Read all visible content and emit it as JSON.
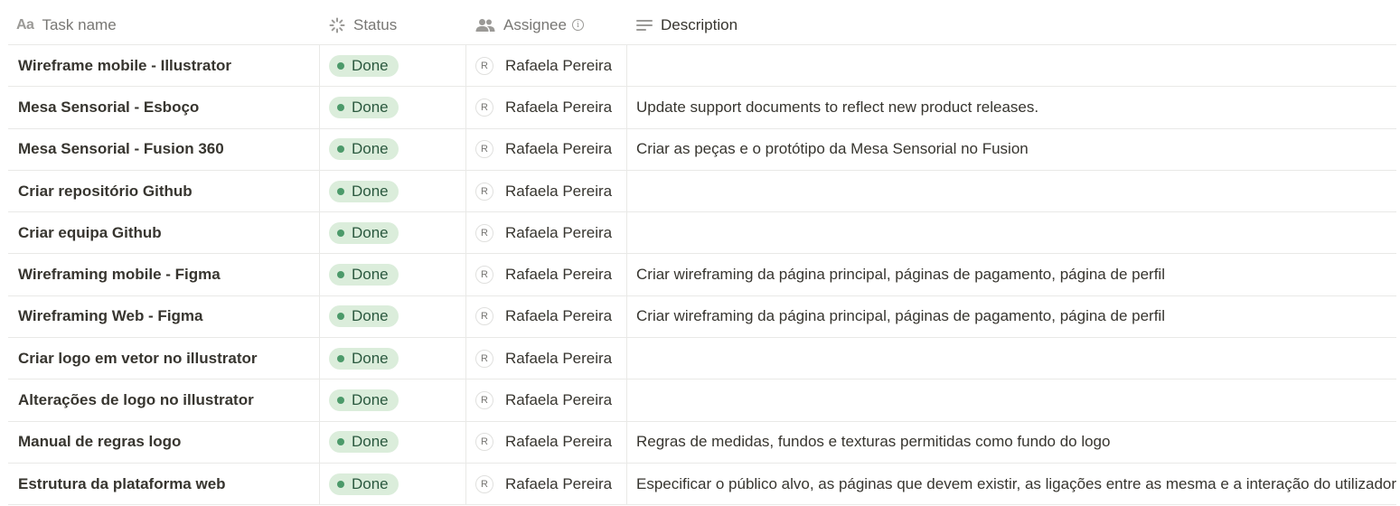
{
  "header": {
    "task_name": "Task name",
    "status": "Status",
    "assignee": "Assignee",
    "description": "Description",
    "task_name_icon": "Aa",
    "info_icon_glyph": "i"
  },
  "colors": {
    "done_bg": "#dbeddb",
    "done_dot": "#4c9a6a",
    "done_text": "#2b593f",
    "border": "#e9e9e7",
    "muted_text": "#787774"
  },
  "rows": [
    {
      "name": "Wireframe mobile - Illustrator",
      "status": "Done",
      "assignee_initial": "R",
      "assignee": "Rafaela Pereira",
      "description": ""
    },
    {
      "name": "Mesa Sensorial - Esboço",
      "status": "Done",
      "assignee_initial": "R",
      "assignee": "Rafaela Pereira",
      "description": "Update support documents to reflect new product releases."
    },
    {
      "name": "Mesa Sensorial - Fusion 360",
      "status": "Done",
      "assignee_initial": "R",
      "assignee": "Rafaela Pereira",
      "description": "Criar as peças e o protótipo da Mesa Sensorial no Fusion"
    },
    {
      "name": "Criar repositório Github",
      "status": "Done",
      "assignee_initial": "R",
      "assignee": "Rafaela Pereira",
      "description": ""
    },
    {
      "name": "Criar equipa Github",
      "status": "Done",
      "assignee_initial": "R",
      "assignee": "Rafaela Pereira",
      "description": ""
    },
    {
      "name": "Wireframing mobile - Figma",
      "status": "Done",
      "assignee_initial": "R",
      "assignee": "Rafaela Pereira",
      "description": "Criar wireframing da página principal, páginas de pagamento, página de perfil"
    },
    {
      "name": "Wireframing Web - Figma",
      "status": "Done",
      "assignee_initial": "R",
      "assignee": "Rafaela Pereira",
      "description": "Criar wireframing da página principal, páginas de pagamento, página de perfil"
    },
    {
      "name": "Criar logo em vetor no illustrator",
      "status": "Done",
      "assignee_initial": "R",
      "assignee": "Rafaela Pereira",
      "description": ""
    },
    {
      "name": "Alterações de logo no illustrator",
      "status": "Done",
      "assignee_initial": "R",
      "assignee": "Rafaela Pereira",
      "description": ""
    },
    {
      "name": "Manual de regras logo",
      "status": "Done",
      "assignee_initial": "R",
      "assignee": "Rafaela Pereira",
      "description": "Regras de medidas, fundos e texturas permitidas como fundo do logo"
    },
    {
      "name": "Estrutura da plataforma web",
      "status": "Done",
      "assignee_initial": "R",
      "assignee": "Rafaela Pereira",
      "description": "Especificar o público alvo, as páginas que devem existir, as ligações entre as mesma e a interação do utilizador"
    }
  ]
}
